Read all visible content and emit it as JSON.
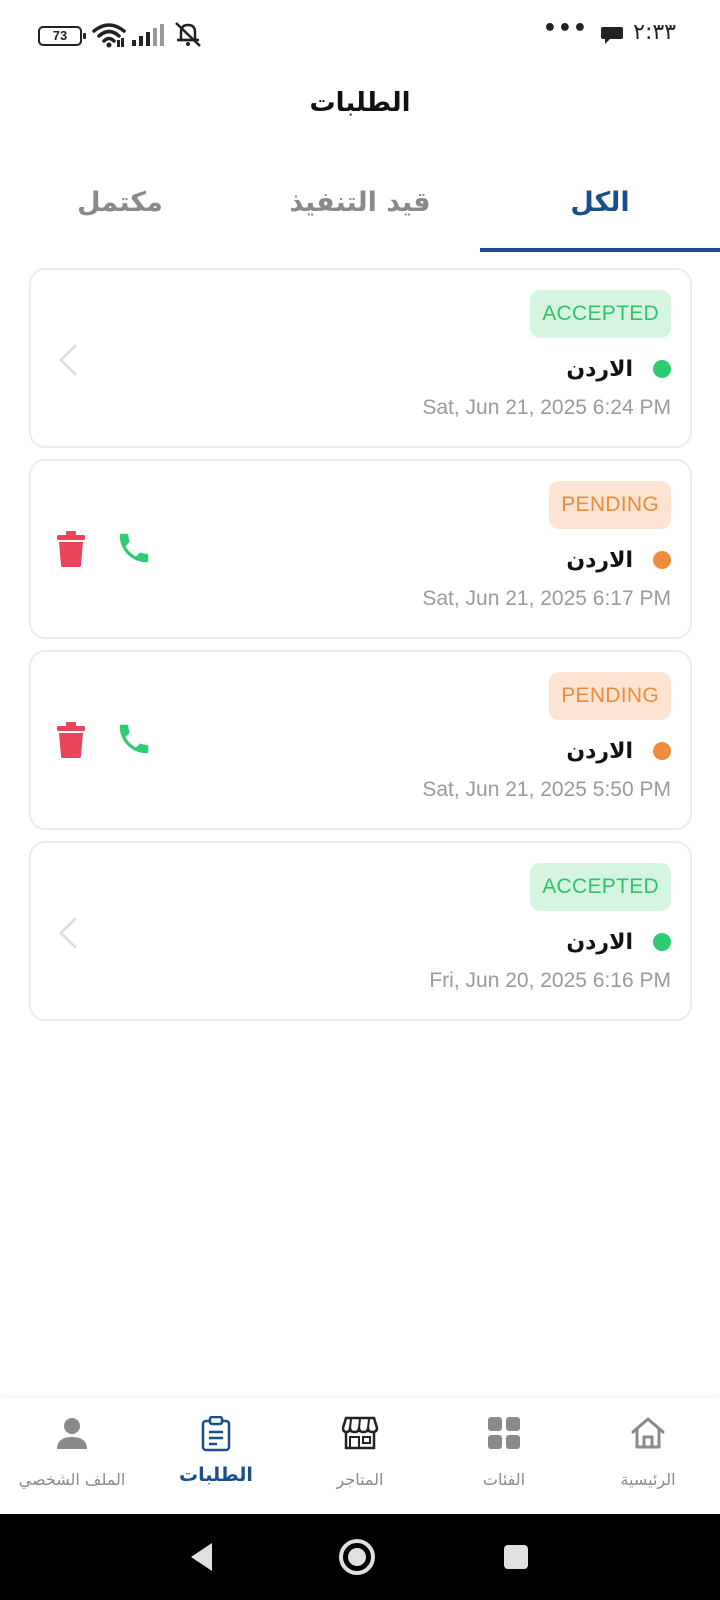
{
  "status_bar": {
    "battery": "73",
    "time": "٢:٣٣",
    "dots": "•••"
  },
  "title": "الطلبات",
  "tabs": [
    {
      "label": "الكل",
      "active": true
    },
    {
      "label": "قيد التنفيذ",
      "active": false
    },
    {
      "label": "مكتمل",
      "active": false
    }
  ],
  "orders": [
    {
      "status": "ACCEPTED",
      "country": "الاردن",
      "date": "Sat, Jun 21, 2025 6:24 PM"
    },
    {
      "status": "PENDING",
      "country": "الاردن",
      "date": "Sat, Jun 21, 2025 6:17 PM"
    },
    {
      "status": "PENDING",
      "country": "الاردن",
      "date": "Sat, Jun 21, 2025 5:50 PM"
    },
    {
      "status": "ACCEPTED",
      "country": "الاردن",
      "date": "Fri, Jun 20, 2025 6:16 PM"
    }
  ],
  "colors": {
    "accent": "#1b4f8c",
    "accepted": "#2fc26a",
    "pending": "#ef8b3c",
    "delete": "#e8445a",
    "call": "#2ecc71"
  },
  "bottom_nav": [
    {
      "label": "الملف الشخصي",
      "icon": "person-icon",
      "active": false
    },
    {
      "label": "الطلبات",
      "icon": "clipboard-icon",
      "active": true
    },
    {
      "label": "المتاجر",
      "icon": "store-icon",
      "active": false
    },
    {
      "label": "الفئات",
      "icon": "grid-icon",
      "active": false
    },
    {
      "label": "الرئيسية",
      "icon": "home-icon",
      "active": false
    }
  ]
}
